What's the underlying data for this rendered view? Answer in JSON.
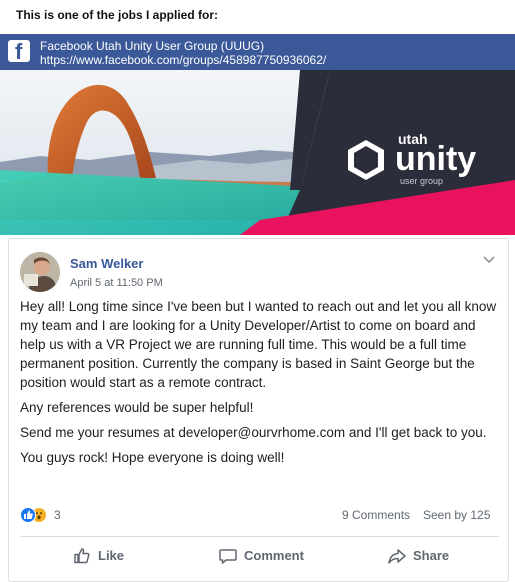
{
  "intro_text": "This is one of the jobs I applied for:",
  "group": {
    "name": "Facebook Utah Unity User Group (UUUG)",
    "url": "https://www.facebook.com/groups/458987750936062/",
    "banner": {
      "brand_top": "utah",
      "brand_main": "unity",
      "brand_sub": "user group"
    }
  },
  "post": {
    "author": "Sam Welker",
    "timestamp": "April 5 at 11:50 PM",
    "paragraphs": [
      "Hey all! Long time since I've been but I wanted to reach out and let you all know my team and I are looking for a Unity Developer/Artist to come on board and help us with a VR Project we are running full time. This would be a full time permanent position. Currently the company is based in Saint George but the position would start as a remote contract.",
      "Any references would be super helpful!",
      "Send me your resumes at developer@ourvrhome.com and I'll get back to you.",
      "You guys rock! Hope everyone is doing well!"
    ],
    "reaction_count": "3",
    "comments": "9 Comments",
    "seen_by": "Seen by 125"
  },
  "actions": {
    "like": "Like",
    "comment": "Comment",
    "share": "Share"
  },
  "icons": [
    "facebook-logo-icon",
    "chevron-down-icon",
    "like-reaction-icon",
    "wow-reaction-icon",
    "thumbs-up-icon",
    "comment-icon",
    "share-icon"
  ],
  "colors": {
    "facebook_blue": "#3b5998",
    "link_blue": "#385898",
    "banner_dark": "#2b2d3a",
    "banner_pink": "#e8125f",
    "banner_teal": "#2fc1b0"
  }
}
